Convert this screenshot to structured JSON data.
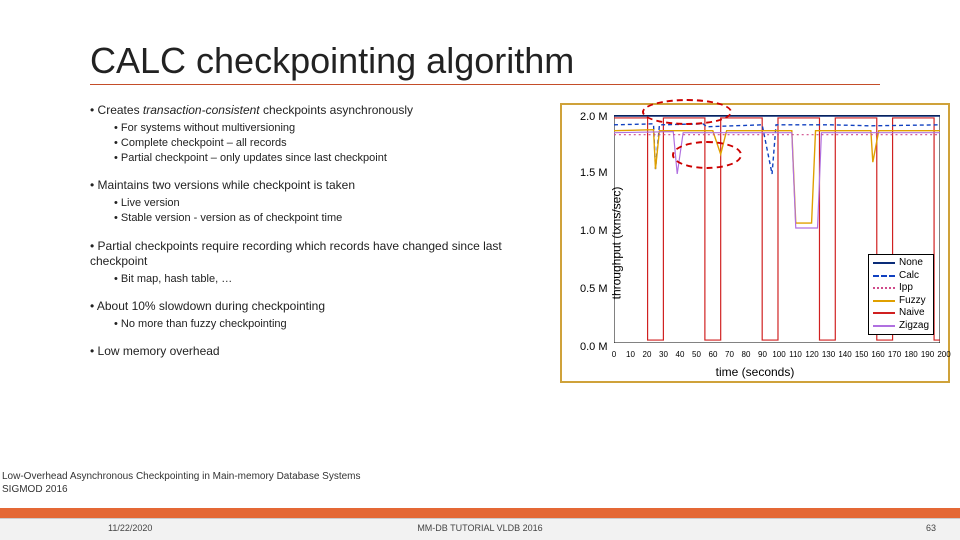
{
  "title": "CALC checkpointing algorithm",
  "bullets": {
    "b1": "Creates transaction-consistent checkpoints asynchronously",
    "b1_sub": [
      "For systems without multiversioning",
      "Complete checkpoint – all records",
      "Partial checkpoint – only updates since last checkpoint"
    ],
    "b2": "Maintains two versions while checkpoint is taken",
    "b2_sub": [
      "Live version",
      "Stable version - version as of checkpoint time"
    ],
    "b3": "Partial checkpoints require recording which records have changed since last checkpoint",
    "b3_sub": [
      "Bit map, hash table, …"
    ],
    "b4": "About 10% slowdown during checkpointing",
    "b4_sub": [
      "No more than fuzzy checkpointing"
    ],
    "b5": "Low memory overhead"
  },
  "citation_l1": "Low-Overhead Asynchronous Checkpointing in Main-memory Database Systems",
  "citation_l2": "SIGMOD 2016",
  "footer": {
    "date": "11/22/2020",
    "center": "MM-DB TUTORIAL VLDB 2016",
    "page": "63"
  },
  "chart_data": {
    "type": "line",
    "title": "",
    "xlabel": "time (seconds)",
    "ylabel": "throughput (txns/sec)",
    "xlim": [
      0,
      200
    ],
    "ylim": [
      0,
      2.0
    ],
    "xticks": [
      0,
      10,
      20,
      30,
      40,
      50,
      60,
      70,
      80,
      90,
      100,
      110,
      120,
      130,
      140,
      150,
      160,
      170,
      180,
      190,
      200
    ],
    "yticks": [
      "0.0 M",
      "0.5 M",
      "1.0 M",
      "1.5 M",
      "2.0 M"
    ],
    "legend_pos": "bottom-right",
    "series": [
      {
        "name": "None",
        "color": "#0a2c78",
        "dash": "",
        "y_approx": 2.05
      },
      {
        "name": "Calc",
        "color": "#1040c0",
        "dash": "4,3",
        "y_approx": 1.95
      },
      {
        "name": "Ipp",
        "color": "#d04a8a",
        "dash": "2,2",
        "y_approx": 1.88
      },
      {
        "name": "Fuzzy",
        "color": "#e0a000",
        "dash": "",
        "y_approx": 1.9
      },
      {
        "name": "Naive",
        "color": "#d02020",
        "dash": "",
        "y_approx": null
      },
      {
        "name": "Zigzag",
        "color": "#b070e0",
        "dash": "",
        "y_approx": 1.9
      }
    ],
    "naive_cycle": {
      "period_s": 35,
      "high": 2.0,
      "low": 0.02,
      "low_duration_s": 8
    }
  }
}
